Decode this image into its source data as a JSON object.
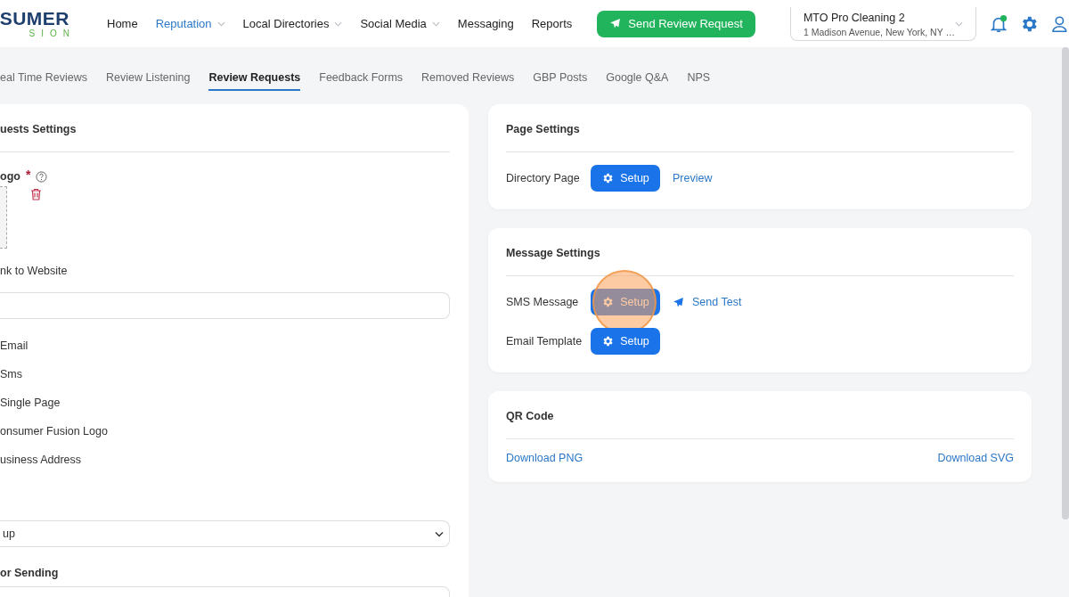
{
  "header": {
    "logo": {
      "top": "SUMER",
      "bottom": "SION"
    },
    "nav": [
      {
        "label": "Home",
        "selected": false,
        "dropdown": false
      },
      {
        "label": "Reputation",
        "selected": true,
        "dropdown": true
      },
      {
        "label": "Local Directories",
        "selected": false,
        "dropdown": true
      },
      {
        "label": "Social Media",
        "selected": false,
        "dropdown": true
      },
      {
        "label": "Messaging",
        "selected": false,
        "dropdown": false
      },
      {
        "label": "Reports",
        "selected": false,
        "dropdown": false
      }
    ],
    "action_button": "Send Review Request",
    "location": {
      "name": "MTO Pro Cleaning 2",
      "address": "1 Madison Avenue, New York, NY …"
    },
    "notification_dot": true
  },
  "tabs": [
    {
      "label": "eal Time Reviews",
      "selected": false
    },
    {
      "label": "Review Listening",
      "selected": false
    },
    {
      "label": "Review Requests",
      "selected": true
    },
    {
      "label": "Feedback Forms",
      "selected": false
    },
    {
      "label": "Removed Reviews",
      "selected": false
    },
    {
      "label": "GBP Posts",
      "selected": false
    },
    {
      "label": "Google Q&A",
      "selected": false
    },
    {
      "label": "NPS",
      "selected": false
    }
  ],
  "left_panel": {
    "title": "uests Settings",
    "logo_field": {
      "label": "ogo",
      "required": true,
      "required_mark": "*"
    },
    "link_field": {
      "label": "nk to Website"
    },
    "options": [
      "Email",
      "Sms",
      "Single Page",
      "onsumer Fusion Logo",
      "usiness Address"
    ],
    "select": {
      "value": "up"
    },
    "sending_label": "or Sending"
  },
  "page_settings": {
    "title": "Page Settings",
    "rows": [
      {
        "label": "Directory Page",
        "button": "Setup",
        "link": "Preview",
        "click_marker": false
      }
    ]
  },
  "message_settings": {
    "title": "Message Settings",
    "rows": [
      {
        "label": "SMS Message",
        "button": "Setup",
        "test_link": "Send Test",
        "click_marker": true
      },
      {
        "label": "Email Template",
        "button": "Setup",
        "click_marker": false
      }
    ]
  },
  "qr_code": {
    "title": "QR Code",
    "links": [
      "Download PNG",
      "Download SVG"
    ]
  }
}
